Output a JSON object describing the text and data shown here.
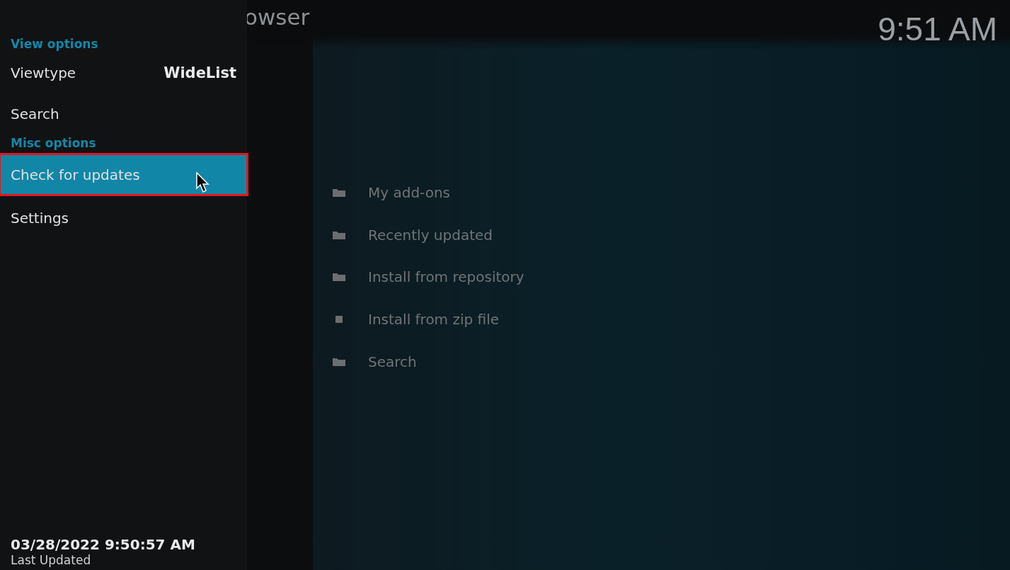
{
  "header": {
    "title": "owser",
    "clock": "9:51 AM"
  },
  "sidebar": {
    "items": [
      {
        "kind": "header",
        "label": "View options"
      },
      {
        "kind": "option",
        "label": "Viewtype",
        "value": "WideList",
        "selected": false
      },
      {
        "kind": "item",
        "label": "Search",
        "selected": false
      },
      {
        "kind": "header",
        "label": "Misc options"
      },
      {
        "kind": "item",
        "label": "Check for updates",
        "selected": true
      },
      {
        "kind": "item",
        "label": "Settings",
        "selected": false
      }
    ],
    "footer": {
      "timestamp": "03/28/2022 9:50:57 AM",
      "caption": "Last Updated"
    }
  },
  "list": {
    "items": [
      {
        "kind": "folder",
        "label": "My add-ons"
      },
      {
        "kind": "folder",
        "label": "Recently updated"
      },
      {
        "kind": "folder",
        "label": "Install from repository"
      },
      {
        "kind": "file",
        "label": "Install from zip file"
      },
      {
        "kind": "folder",
        "label": "Search"
      }
    ]
  }
}
